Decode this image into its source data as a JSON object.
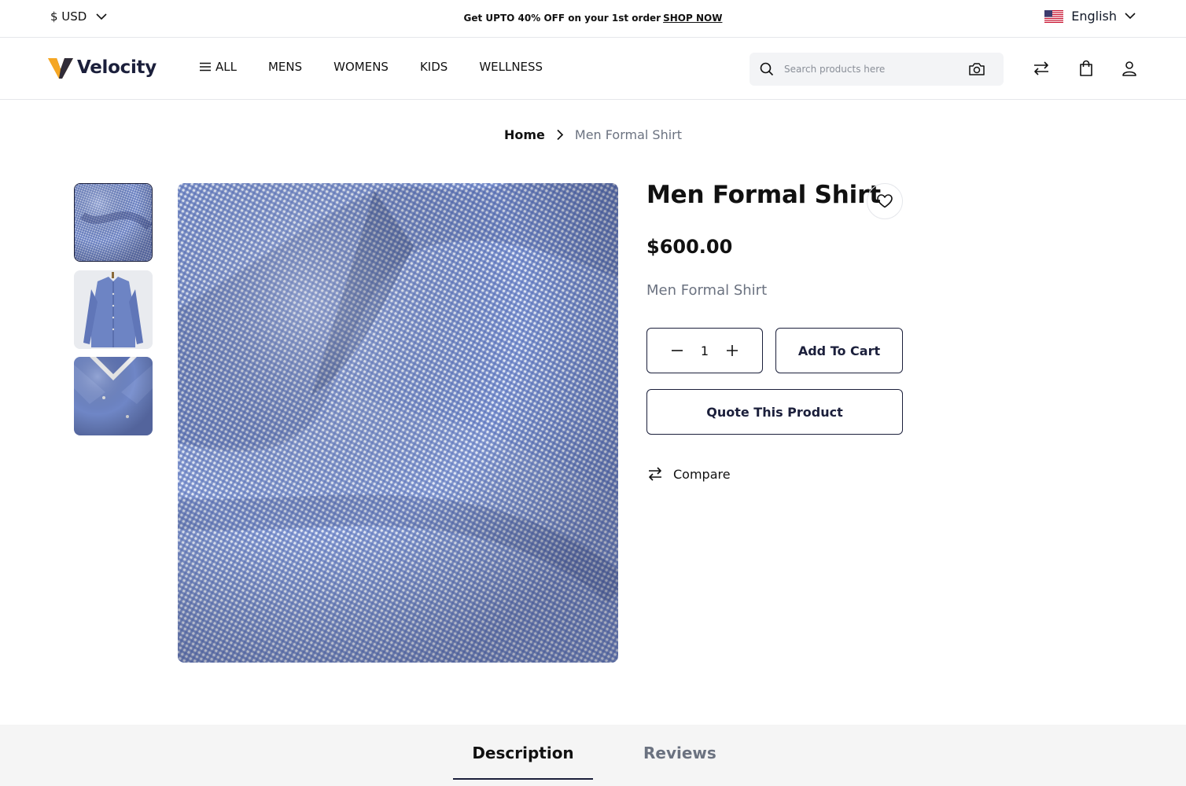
{
  "topbar": {
    "currency": "$ USD",
    "promo_text": "Get UPTO 40% OFF on your 1st order",
    "promo_link": "SHOP NOW",
    "language": "English"
  },
  "header": {
    "logo_text": "Velocity",
    "nav": [
      "ALL",
      "MENS",
      "WOMENS",
      "KIDS",
      "WELLNESS"
    ],
    "search_placeholder": "Search products here"
  },
  "breadcrumb": {
    "home": "Home",
    "current": "Men Formal Shirt"
  },
  "product": {
    "title": "Men Formal Shirt",
    "price": "$600.00",
    "short_description": "Men Formal Shirt",
    "quantity": "1",
    "add_to_cart": "Add To Cart",
    "quote": "Quote This Product",
    "compare": "Compare"
  },
  "tabs": {
    "description": "Description",
    "reviews": "Reviews"
  },
  "colors": {
    "brand_navy": "#1b1f3b",
    "logo_orange": "#f5a623",
    "fabric_blue": "#6b82c4"
  },
  "icons": [
    "chevron-down-icon",
    "us-flag-icon",
    "menu-icon",
    "search-icon",
    "camera-icon",
    "compare-icon",
    "bag-icon",
    "user-icon",
    "chevron-right-icon",
    "heart-icon",
    "minus-icon",
    "plus-icon"
  ]
}
